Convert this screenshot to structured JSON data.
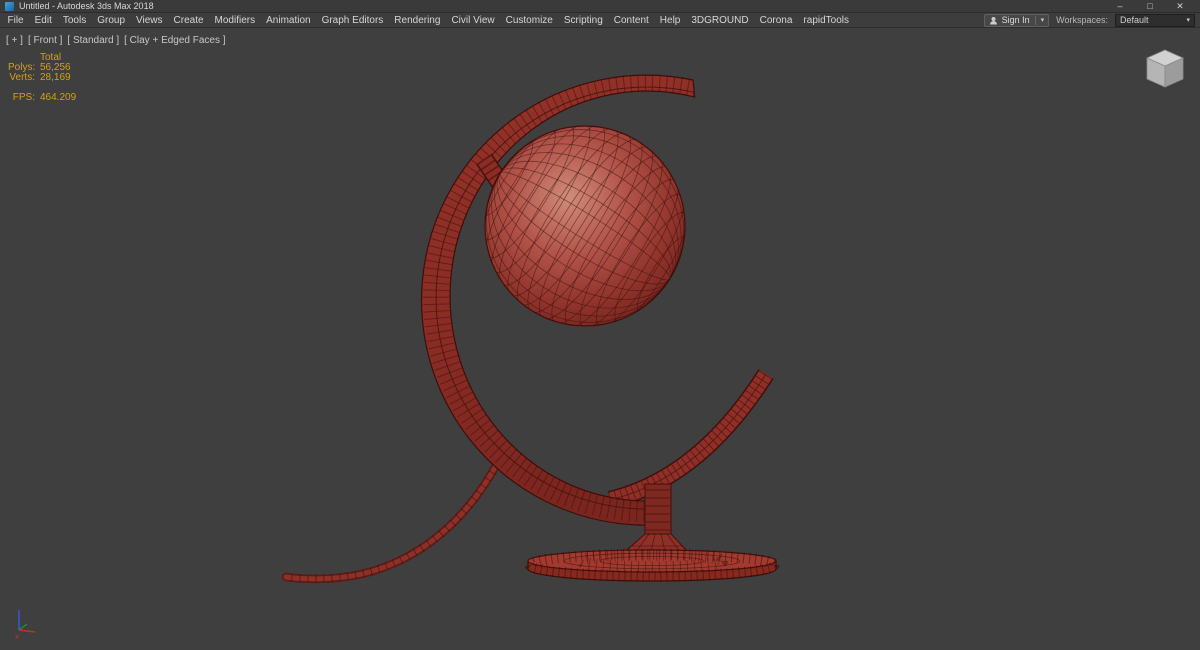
{
  "window": {
    "title": "Untitled - Autodesk 3ds Max 2018",
    "minimize": "–",
    "maximize": "□",
    "close": "✕"
  },
  "menubar": {
    "items": [
      "File",
      "Edit",
      "Tools",
      "Group",
      "Views",
      "Create",
      "Modifiers",
      "Animation",
      "Graph Editors",
      "Rendering",
      "Civil View",
      "Customize",
      "Scripting",
      "Content",
      "Help",
      "3DGROUND",
      "Corona",
      "rapidTools"
    ]
  },
  "account": {
    "sign_in": "Sign In",
    "caret": "▾"
  },
  "workspaces": {
    "label": "Workspaces:",
    "value": "Default",
    "caret": "▾"
  },
  "viewport": {
    "labels": {
      "plus": "[ + ]",
      "view": "[ Front ]",
      "shading": "[ Standard ]",
      "style": "[ Clay + Edged Faces ]"
    },
    "stats": {
      "total": "Total",
      "polys_label": "Polys:",
      "polys": "56,256",
      "verts_label": "Verts:",
      "verts": "28,169",
      "fps_label": "FPS:",
      "fps": "464.209"
    }
  },
  "colors": {
    "stats_text": "#d4a012",
    "model_red": "#9a362d",
    "viewport_bg": "#3f3f3f",
    "menubar_bg": "#3d3d3d"
  }
}
